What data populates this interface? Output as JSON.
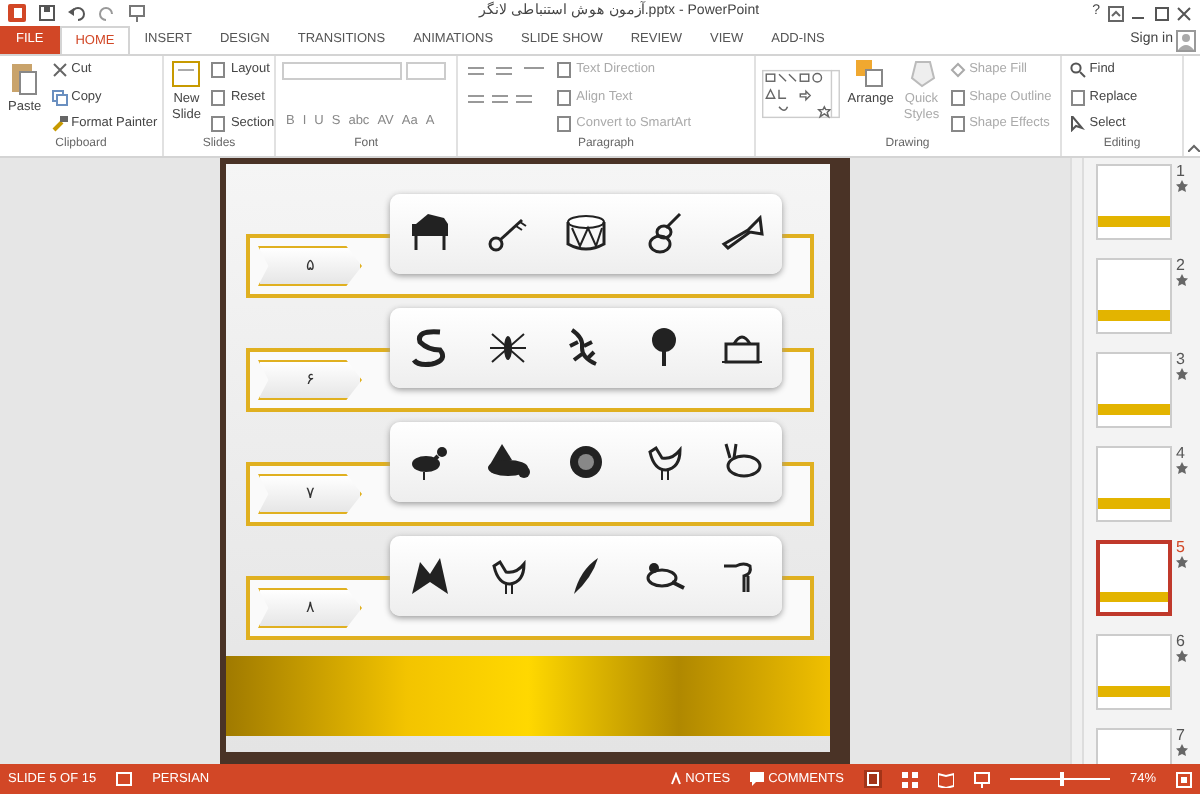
{
  "window": {
    "title": "آزمون هوش استنباطی لانگر.pptx - PowerPoint",
    "help": "?",
    "sign_in": "Sign in"
  },
  "tabs": [
    {
      "label": "FILE",
      "kind": "file",
      "selected": false
    },
    {
      "label": "HOME",
      "kind": "tab",
      "selected": true
    },
    {
      "label": "INSERT",
      "kind": "tab",
      "selected": false
    },
    {
      "label": "DESIGN",
      "kind": "tab",
      "selected": false
    },
    {
      "label": "TRANSITIONS",
      "kind": "tab",
      "selected": false
    },
    {
      "label": "ANIMATIONS",
      "kind": "tab",
      "selected": false
    },
    {
      "label": "SLIDE SHOW",
      "kind": "tab",
      "selected": false
    },
    {
      "label": "REVIEW",
      "kind": "tab",
      "selected": false
    },
    {
      "label": "VIEW",
      "kind": "tab",
      "selected": false
    },
    {
      "label": "ADD-INS",
      "kind": "tab",
      "selected": false
    }
  ],
  "ribbon": {
    "clipboard": {
      "label": "Clipboard",
      "paste": "Paste",
      "items": [
        {
          "label": "Cut",
          "disabled": false
        },
        {
          "label": "Copy",
          "disabled": false
        },
        {
          "label": "Format Painter",
          "disabled": false
        }
      ]
    },
    "slides": {
      "label": "Slides",
      "new_slide": "New Slide",
      "items": [
        {
          "label": "Layout",
          "disabled": false
        },
        {
          "label": "Reset",
          "disabled": false
        },
        {
          "label": "Section",
          "disabled": false
        }
      ]
    },
    "font": {
      "label": "Font",
      "buttons": [
        "B",
        "I",
        "U",
        "S",
        "abc",
        "AV",
        "Aa",
        "A"
      ]
    },
    "paragraph": {
      "label": "Paragraph",
      "items": [
        {
          "label": "Text Direction",
          "disabled": true
        },
        {
          "label": "Align Text",
          "disabled": true
        },
        {
          "label": "Convert to SmartArt",
          "disabled": true
        }
      ]
    },
    "drawing": {
      "label": "Drawing",
      "arrange": "Arrange",
      "quick_styles": "Quick Styles",
      "items": [
        {
          "label": "Shape Fill",
          "disabled": true
        },
        {
          "label": "Shape Outline",
          "disabled": true
        },
        {
          "label": "Shape Effects",
          "disabled": true
        }
      ]
    },
    "editing": {
      "label": "Editing",
      "items": [
        {
          "label": "Find",
          "disabled": false
        },
        {
          "label": "Replace",
          "disabled": false
        },
        {
          "label": "Select",
          "disabled": false
        }
      ]
    }
  },
  "slide": {
    "rows": [
      {
        "number": "۵"
      },
      {
        "number": "۶"
      },
      {
        "number": "۷"
      },
      {
        "number": "۸"
      }
    ]
  },
  "thumbnails": [
    {
      "number": "1",
      "selected": false
    },
    {
      "number": "2",
      "selected": false
    },
    {
      "number": "3",
      "selected": false
    },
    {
      "number": "4",
      "selected": false
    },
    {
      "number": "5",
      "selected": true
    },
    {
      "number": "6",
      "selected": false
    },
    {
      "number": "7",
      "selected": false
    }
  ],
  "status_bar": {
    "slide": "SLIDE 5 OF 15",
    "language": "PERSIAN",
    "notes": "NOTES",
    "comments": "COMMENTS",
    "zoom": "74%",
    "zoom_level": {
      "level": 0.5
    }
  }
}
